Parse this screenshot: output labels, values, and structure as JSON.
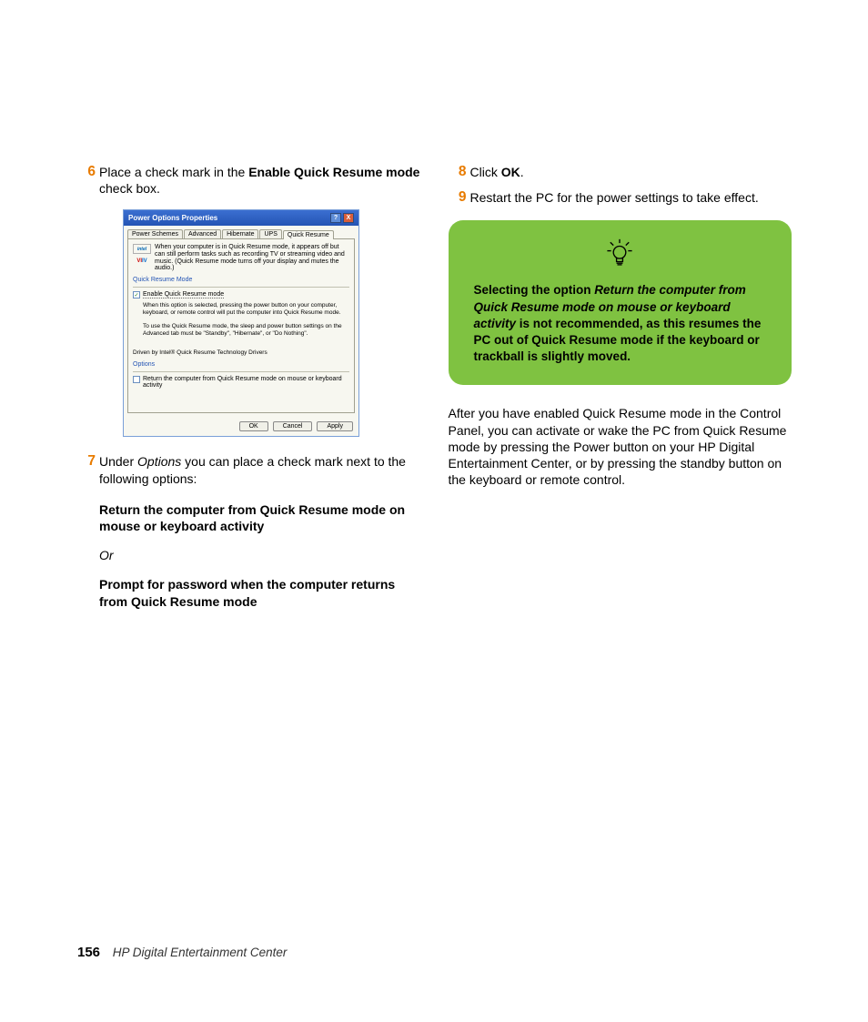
{
  "steps": {
    "s6": {
      "num": "6",
      "pre": "Place a check mark in the ",
      "bold": "Enable Quick Resume mode",
      "post": " check box."
    },
    "s7": {
      "num": "7",
      "pre": "Under ",
      "it": "Options",
      "post": " you can place a check mark next to the following options:"
    },
    "s8": {
      "num": "8",
      "pre": "Click ",
      "bold": "OK",
      "post": "."
    },
    "s9": {
      "num": "9",
      "text": "Restart the PC for the power settings to take effect."
    }
  },
  "sub": {
    "opt1": "Return the computer from Quick Resume mode on mouse or keyboard activity",
    "or": "Or",
    "opt2": "Prompt for password when the computer returns from Quick Resume mode"
  },
  "dialog": {
    "title": "Power Options Properties",
    "help": "?",
    "close": "X",
    "tabs": [
      "Power Schemes",
      "Advanced",
      "Hibernate",
      "UPS",
      "Quick Resume"
    ],
    "intel": "intel",
    "viiv": {
      "a": "VI",
      "b": "IV"
    },
    "desc": "When your computer is in Quick Resume mode, it appears off but can still perform tasks such as recording TV or streaming video and music. (Quick Resume mode turns off your display and mutes the audio.)",
    "group1": "Quick Resume Mode",
    "chk1": "Enable Quick Resume mode",
    "note1": "When this option is selected, pressing the power button on your computer, keyboard, or remote control will put the computer into Quick Resume mode.",
    "note2": "To use the Quick Resume mode, the sleep and power button settings on the Advanced tab must be \"Standby\", \"Hibernate\", or \"Do Nothing\".",
    "driven": "Driven by Intel® Quick Resume Technology Drivers",
    "group2": "Options",
    "chk2": "Return the computer from Quick Resume mode on mouse or keyboard activity",
    "btns": {
      "ok": "OK",
      "cancel": "Cancel",
      "apply": "Apply"
    }
  },
  "tip": {
    "pre": "Selecting the option ",
    "it": "Return the computer from Quick Resume mode on mouse or keyboard activity",
    "post": " is not recommended, as this resumes the PC out of Quick Resume mode if the keyboard or trackball is slightly moved."
  },
  "after": "After you have enabled Quick Resume mode in the Control Panel, you can activate or wake the PC from Quick Resume mode by pressing the Power button on your HP Digital Entertainment Center, or by pressing the standby button on the keyboard or remote control.",
  "footer": {
    "page": "156",
    "title": "HP Digital Entertainment Center"
  }
}
